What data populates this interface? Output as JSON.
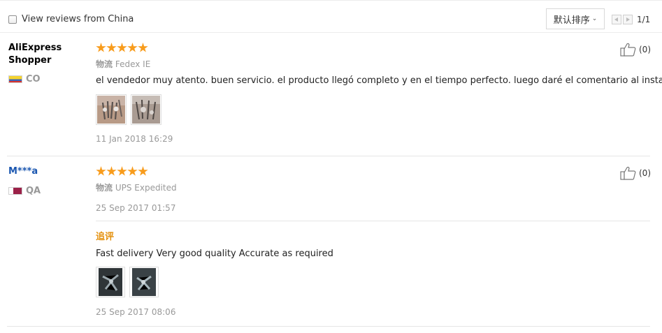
{
  "toolbar": {
    "filter_label": "View reviews from China",
    "sort_label": "默认排序",
    "page_indicator": "1/1"
  },
  "reviews": [
    {
      "user": "AliExpress Shopper",
      "user_line1": "AliExpress",
      "user_line2": "Shopper",
      "country": "CO",
      "rating": 5,
      "shipping_label": "物流",
      "shipping_method": "Fedex IE",
      "text": "el vendedor muy atento. buen servicio. el producto llegó completo y en el tiempo perfecto. luego daré el comentario al instalar.",
      "photos": 2,
      "date": "11 Jan 2018 16:29",
      "helpful": "(0)"
    },
    {
      "user": "M***a",
      "country": "QA",
      "rating": 5,
      "shipping_label": "物流",
      "shipping_method": "UPS Expedited",
      "date": "25 Sep 2017 01:57",
      "helpful": "(0)",
      "followup": {
        "label": "追评",
        "text": "Fast delivery Very good quality Accurate as required",
        "photos": 2,
        "date": "25 Sep 2017 08:06"
      }
    }
  ],
  "colors": {
    "star": "#f89c1c",
    "followup_label": "#e4910f",
    "username_link": "#1a56b0",
    "muted": "#999999"
  },
  "icons": {
    "filter": "checkbox",
    "sort": "chevron-down-icon",
    "prev": "arrow-left-icon",
    "next": "arrow-right-icon",
    "helpful": "thumbs-up-icon",
    "rating": "star-icon"
  }
}
